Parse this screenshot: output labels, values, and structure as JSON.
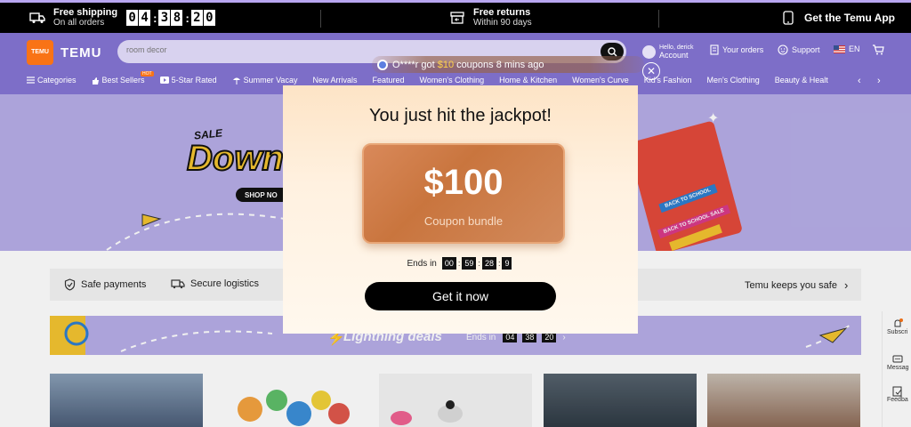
{
  "topbar": {
    "shipping_line1": "Free shipping",
    "shipping_line2": "On all orders",
    "timer": [
      "0",
      "4",
      ":",
      "3",
      "8",
      ":",
      "2",
      "0"
    ],
    "returns_line1": "Free returns",
    "returns_line2": "Within 90 days",
    "app_label": "Get the Temu App"
  },
  "header": {
    "logo_small": "TEMU",
    "logo_text": "TEMU",
    "search_placeholder": "room decor",
    "account_line1": "Hello, derick",
    "account_line2": "Account",
    "orders": "Your orders",
    "support": "Support",
    "language": "EN"
  },
  "notification": {
    "user": "O****r",
    "got": "got",
    "amount": "$10",
    "rest": "coupons 8 mins ago"
  },
  "categories": [
    "Categories",
    "Best Sellers",
    "5-Star Rated",
    "Summer Vacay",
    "New Arrivals",
    "Featured",
    "Women's Clothing",
    "Home & Kitchen",
    "Women's Curve",
    "Kid's Fashion",
    "Men's Clothing",
    "Beauty & Healt"
  ],
  "hot_badge": "HOT",
  "banner": {
    "sale": "SALE",
    "headline": "Down t",
    "shop_now": "SHOP NO",
    "ribbon1": "BACK TO SCHOOL",
    "ribbon2": "BACK TO SCHOOL SALE"
  },
  "trust": {
    "safe_payments": "Safe payments",
    "secure_logistics": "Secure logistics",
    "keeps_safe": "Temu keeps you safe"
  },
  "lightning": {
    "title": "Lightning deals",
    "ends_in": "Ends in",
    "h": "04",
    "m": "38",
    "s": "20"
  },
  "side": {
    "subscribe": "Subscri",
    "messages": "Messag",
    "feedback": "Feedba"
  },
  "modal": {
    "title": "You just hit the jackpot!",
    "amount": "$100",
    "subtitle": "Coupon bundle",
    "ends_in": "Ends in",
    "hh": "00",
    "mm": "59",
    "ss": "28",
    "t": "9",
    "cta": "Get it now"
  },
  "colors": {
    "brand_purple": "#7d6ec8",
    "brand_orange": "#f97316",
    "coupon": "#c9753e"
  }
}
